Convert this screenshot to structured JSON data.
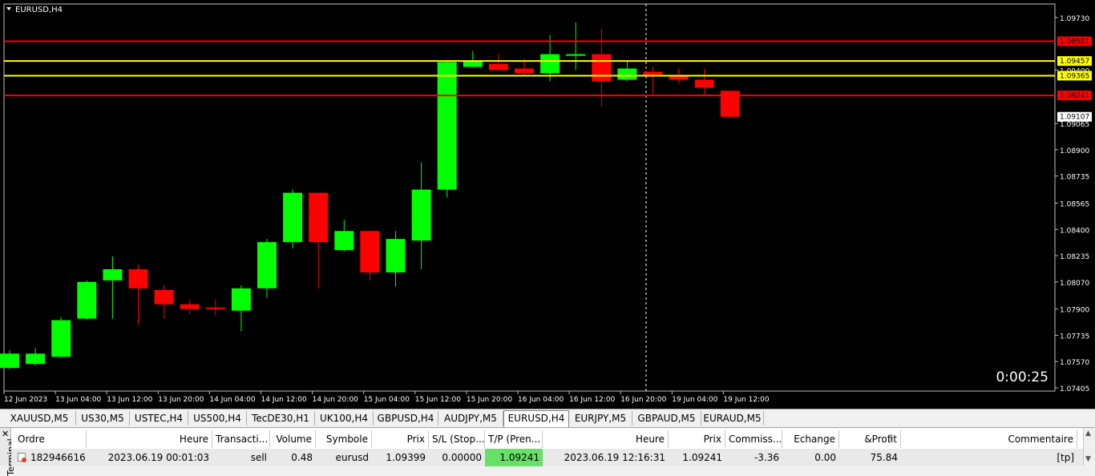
{
  "chart": {
    "title": "EURUSD,H4",
    "timer": "0:00:25",
    "price_labels": [
      "1.09730",
      "1.09400",
      "1.09065",
      "1.08900",
      "1.08735",
      "1.08565",
      "1.08400",
      "1.08235",
      "1.08070",
      "1.07900",
      "1.07735",
      "1.07570",
      "1.07405"
    ],
    "hlines": [
      {
        "price": 1.09581,
        "label": "1.09581",
        "color": "#ff0000"
      },
      {
        "price": 1.09457,
        "label": "1.09457",
        "color": "#ffff00"
      },
      {
        "price": 1.09365,
        "label": "1.09365",
        "color": "#ffff00"
      },
      {
        "price": 1.09241,
        "label": "1.09241",
        "color": "#ff0000"
      }
    ],
    "current_price_label": "1.09107",
    "time_labels": [
      "12 Jun 2023",
      "13 Jun 04:00",
      "13 Jun 12:00",
      "13 Jun 20:00",
      "14 Jun 04:00",
      "14 Jun 12:00",
      "14 Jun 20:00",
      "15 Jun 04:00",
      "15 Jun 12:00",
      "15 Jun 20:00",
      "16 Jun 04:00",
      "16 Jun 12:00",
      "16 Jun 20:00",
      "19 Jun 04:00",
      "19 Jun 12:00"
    ],
    "bull_color": "#00ff00",
    "bear_color": "#ff0000"
  },
  "chart_data": {
    "type": "candlestick",
    "symbol": "EURUSD,H4",
    "ylim": [
      1.07405,
      1.0973
    ],
    "candles": [
      {
        "o": 1.0753,
        "h": 1.0764,
        "l": 1.0752,
        "c": 1.0762
      },
      {
        "o": 1.07555,
        "h": 1.07655,
        "l": 1.07545,
        "c": 1.0762
      },
      {
        "o": 1.076,
        "h": 1.0785,
        "l": 1.07595,
        "c": 1.0783
      },
      {
        "o": 1.0784,
        "h": 1.0808,
        "l": 1.0783,
        "c": 1.0807
      },
      {
        "o": 1.0808,
        "h": 1.0823,
        "l": 1.0784,
        "c": 1.0815
      },
      {
        "o": 1.0815,
        "h": 1.0818,
        "l": 1.078,
        "c": 1.0803
      },
      {
        "o": 1.0802,
        "h": 1.0805,
        "l": 1.0784,
        "c": 1.0793
      },
      {
        "o": 1.0793,
        "h": 1.0796,
        "l": 1.0787,
        "c": 1.079
      },
      {
        "o": 1.0791,
        "h": 1.0796,
        "l": 1.0786,
        "c": 1.07905
      },
      {
        "o": 1.0789,
        "h": 1.0805,
        "l": 1.0776,
        "c": 1.0803
      },
      {
        "o": 1.0803,
        "h": 1.0834,
        "l": 1.0797,
        "c": 1.0832
      },
      {
        "o": 1.0832,
        "h": 1.0865,
        "l": 1.0828,
        "c": 1.0863
      },
      {
        "o": 1.0863,
        "h": 1.0863,
        "l": 1.0803,
        "c": 1.0832
      },
      {
        "o": 1.0827,
        "h": 1.0846,
        "l": 1.0826,
        "c": 1.0839
      },
      {
        "o": 1.0839,
        "h": 1.0839,
        "l": 1.0808,
        "c": 1.0813
      },
      {
        "o": 1.0813,
        "h": 1.0839,
        "l": 1.0804,
        "c": 1.0834
      },
      {
        "o": 1.0833,
        "h": 1.0882,
        "l": 1.0815,
        "c": 1.0865
      },
      {
        "o": 1.0865,
        "h": 1.0946,
        "l": 1.086,
        "c": 1.0945
      },
      {
        "o": 1.0942,
        "h": 1.0952,
        "l": 1.0942,
        "c": 1.0946
      },
      {
        "o": 1.0944,
        "h": 1.095,
        "l": 1.094,
        "c": 1.094
      },
      {
        "o": 1.0941,
        "h": 1.0947,
        "l": 1.0936,
        "c": 1.0938
      },
      {
        "o": 1.0938,
        "h": 1.0962,
        "l": 1.0933,
        "c": 1.095
      },
      {
        "o": 1.0949,
        "h": 1.097,
        "l": 1.094,
        "c": 1.095
      },
      {
        "o": 1.095,
        "h": 1.0966,
        "l": 1.0917,
        "c": 1.0933
      },
      {
        "o": 1.0934,
        "h": 1.0946,
        "l": 1.0933,
        "c": 1.0941
      },
      {
        "o": 1.0939,
        "h": 1.0942,
        "l": 1.0925,
        "c": 1.0936
      },
      {
        "o": 1.0936,
        "h": 1.0941,
        "l": 1.0932,
        "c": 1.0934
      },
      {
        "o": 1.0934,
        "h": 1.0941,
        "l": 1.0924,
        "c": 1.0929
      },
      {
        "o": 1.0927,
        "h": 1.0927,
        "l": 1.091,
        "c": 1.09107
      }
    ]
  },
  "symbol_tabs": [
    {
      "label": "XAUUSD,M5",
      "active": false
    },
    {
      "label": "US30,M5",
      "active": false
    },
    {
      "label": "USTEC,H4",
      "active": false
    },
    {
      "label": "US500,H4",
      "active": false
    },
    {
      "label": "TecDE30,H1",
      "active": false
    },
    {
      "label": "UK100,H4",
      "active": false
    },
    {
      "label": "GBPUSD,H4",
      "active": false
    },
    {
      "label": "AUDJPY,M5",
      "active": false
    },
    {
      "label": "EURUSD,H4",
      "active": true
    },
    {
      "label": "EURJPY,M5",
      "active": false
    },
    {
      "label": "GBPAUD,M5",
      "active": false
    },
    {
      "label": "EURAUD,M5",
      "active": false
    }
  ],
  "terminal": {
    "side_label": "Terminal",
    "columns": [
      "Ordre",
      "Heure",
      "Transacti...",
      "Volume",
      "Symbole",
      "Prix",
      "S/L (Stop...",
      "T/P (Pren...",
      "Heure",
      "Prix",
      "Commiss...",
      "Echange",
      "&Profit",
      "Commentaire"
    ],
    "sort_indicator": "/",
    "row": {
      "ordre": "182946616",
      "heure_open": "2023.06.19 00:01:03",
      "transaction": "sell",
      "volume": "0.48",
      "symbole": "eurusd",
      "prix_open": "1.09399",
      "sl": "0.00000",
      "tp": "1.09241",
      "heure_close": "2023.06.19 12:16:31",
      "prix_close": "1.09241",
      "commission": "-3.36",
      "echange": "0.00",
      "profit": "75.84",
      "commentaire": "[tp]"
    },
    "tp_highlight_color": "#66e066"
  }
}
